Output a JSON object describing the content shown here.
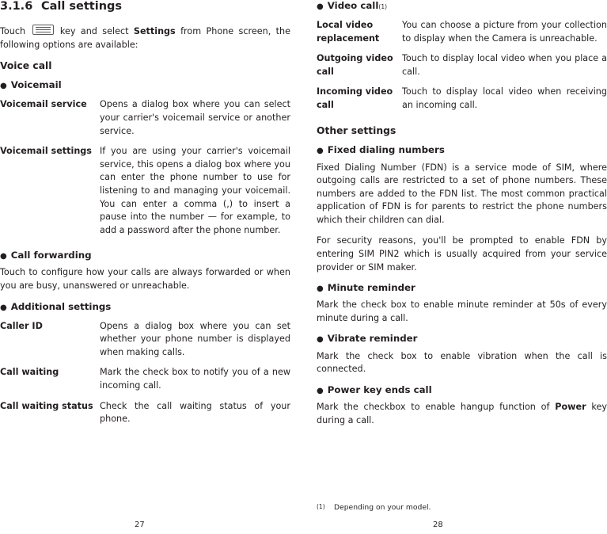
{
  "left_page": {
    "section_number": "3.1.6",
    "section_title": "Call settings",
    "intro_before_key": "Touch",
    "intro_after_key": "key and select",
    "intro_bold": "Settings",
    "intro_end": "from Phone screen, the following options are available:",
    "voice_call_heading": "Voice call",
    "voicemail_heading": "Voicemail",
    "rows": [
      {
        "label": "Voicemail service",
        "desc": "Opens a dialog box where you can select your carrier's voicemail service or another service."
      },
      {
        "label": "Voicemail settings",
        "desc": "If you are using your carrier's voicemail service, this opens a dialog box where you can enter the phone number to use for listening to and managing your voicemail. You can enter a comma (,) to insert a pause into the number — for example, to add a password after the phone number."
      }
    ],
    "call_forwarding_heading": "Call forwarding",
    "call_forwarding_text": "Touch to configure how your calls are always forwarded or  when you are busy, unanswered or unreachable.",
    "additional_settings_heading": "Additional settings",
    "additional_rows": [
      {
        "label": "Caller ID",
        "desc": "Opens a dialog box where you can set whether your phone number is displayed when making calls."
      },
      {
        "label": "Call waiting",
        "desc": "Mark the check box to notify you of a new incoming call."
      },
      {
        "label": "Call waiting status",
        "desc": "Check the call waiting status of your phone."
      }
    ],
    "page_number": "27"
  },
  "right_page": {
    "video_call_heading": "Video call",
    "video_call_footnote_mark": "(1)",
    "video_rows": [
      {
        "label": "Local video replacement",
        "desc": "You can choose a picture from your collection to display when the Camera is unreachable."
      },
      {
        "label": "Outgoing video call",
        "desc": "Touch to display local video when you place a call."
      },
      {
        "label": "Incoming video call",
        "desc": "Touch to display local video when receiving an incoming call."
      }
    ],
    "other_settings_heading": "Other settings",
    "fixed_dialing_heading": "Fixed dialing numbers",
    "fixed_dialing_p1": "Fixed Dialing Number (FDN) is a service mode of SIM, where outgoing calls are restricted to a set of phone numbers. These numbers are added to the FDN list. The most common practical application of FDN is for parents to restrict the phone numbers which their children can dial.",
    "fixed_dialing_p2": "For security reasons, you'll be prompted to enable FDN by entering SIM PIN2 which is usually acquired from your service provider or SIM maker.",
    "minute_reminder_heading": "Minute reminder",
    "minute_reminder_text": "Mark the check box to enable minute reminder at 50s of every minute during a call.",
    "vibrate_reminder_heading": "Vibrate reminder",
    "vibrate_reminder_text": "Mark the check box to enable vibration when the call is connected.",
    "power_key_heading": "Power key ends call",
    "power_key_before": "Mark the checkbox to enable hangup function of",
    "power_key_bold": "Power",
    "power_key_after": "key during a call.",
    "footnote_mark": "(1)",
    "footnote_text": "Depending on your model.",
    "page_number": "28"
  }
}
